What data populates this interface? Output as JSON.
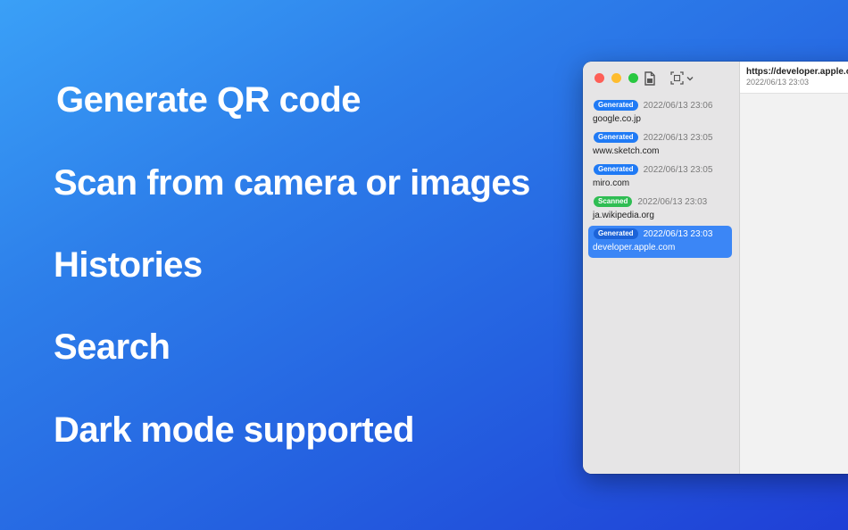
{
  "features": [
    "Generate QR code",
    "Scan from camera or images",
    "Histories",
    "Search",
    "Dark mode supported"
  ],
  "toolbar": {
    "icons": [
      "document-icon",
      "scan-icon",
      "chevron-down-icon"
    ]
  },
  "history": [
    {
      "badge": "Generated",
      "date": "2022/06/13 23:06",
      "host": "google.co.jp",
      "selected": false
    },
    {
      "badge": "Generated",
      "date": "2022/06/13 23:05",
      "host": "www.sketch.com",
      "selected": false
    },
    {
      "badge": "Generated",
      "date": "2022/06/13 23:05",
      "host": "miro.com",
      "selected": false
    },
    {
      "badge": "Scanned",
      "date": "2022/06/13 23:03",
      "host": "ja.wikipedia.org",
      "selected": false
    },
    {
      "badge": "Generated",
      "date": "2022/06/13 23:03",
      "host": "developer.apple.com",
      "selected": true
    }
  ],
  "detail": {
    "title": "https://developer.apple.com",
    "date": "2022/06/13 23:03"
  },
  "colors": {
    "generated": "#1f7af5",
    "scanned": "#2fbd53",
    "selection": "#3b86f6"
  }
}
